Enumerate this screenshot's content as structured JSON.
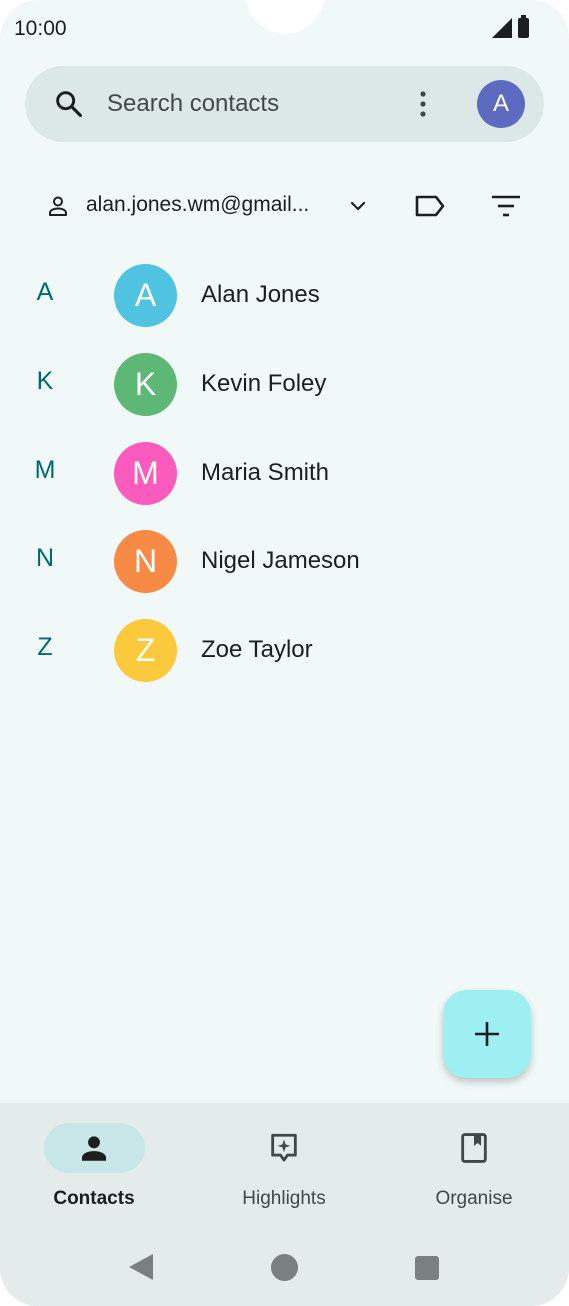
{
  "status_bar": {
    "time": "10:00"
  },
  "search": {
    "placeholder": "Search contacts",
    "avatar_initial": "A"
  },
  "account": {
    "email": "alan.jones.wm@gmail..."
  },
  "contacts": [
    {
      "letter": "A",
      "initial": "A",
      "name": "Alan Jones",
      "color": "#4fc3e0"
    },
    {
      "letter": "K",
      "initial": "K",
      "name": "Kevin Foley",
      "color": "#5cb874"
    },
    {
      "letter": "M",
      "initial": "M",
      "name": "Maria Smith",
      "color": "#fa5bbc"
    },
    {
      "letter": "N",
      "initial": "N",
      "name": "Nigel Jameson",
      "color": "#f78b45"
    },
    {
      "letter": "Z",
      "initial": "Z",
      "name": "Zoe Taylor",
      "color": "#fbc93b"
    }
  ],
  "bottom_nav": {
    "items": [
      {
        "label": "Contacts",
        "icon": "person-icon",
        "active": true
      },
      {
        "label": "Highlights",
        "icon": "highlights-icon",
        "active": false
      },
      {
        "label": "Organise",
        "icon": "bookmark-icon",
        "active": false
      }
    ]
  },
  "colors": {
    "accent": "#006a6a",
    "fab": "#9eeff2",
    "background": "#f1f9f8",
    "search_bar": "#dce8e7",
    "avatar": "#5c6bc0"
  }
}
